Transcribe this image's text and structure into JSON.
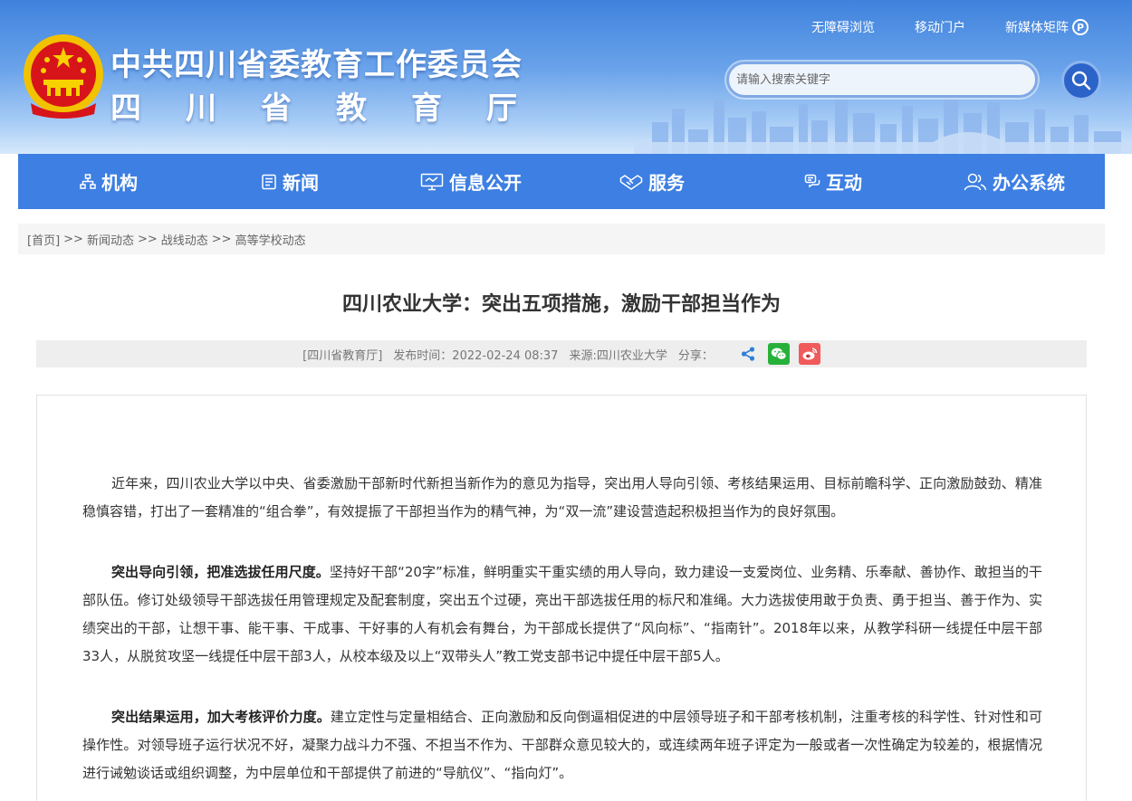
{
  "header": {
    "title_line1": "中共四川省委教育工作委员会",
    "title_line2": "四川省教育厅",
    "top_links": [
      "无障碍浏览",
      "移动门户",
      "新媒体矩阵"
    ],
    "search_placeholder": "请输入搜索关键字"
  },
  "nav": {
    "items": [
      {
        "label": "机构",
        "icon": "org-icon"
      },
      {
        "label": "新闻",
        "icon": "news-icon"
      },
      {
        "label": "信息公开",
        "icon": "monitor-icon"
      },
      {
        "label": "服务",
        "icon": "handshake-icon"
      },
      {
        "label": "互动",
        "icon": "chat-icon"
      },
      {
        "label": "办公系统",
        "icon": "users-icon"
      }
    ]
  },
  "breadcrumb": {
    "home": "[首页]",
    "separator": ">>",
    "items": [
      "新闻动态",
      "战线动态",
      "高等学校动态"
    ]
  },
  "article": {
    "title": "四川农业大学：突出五项措施，激励干部担当作为",
    "meta_site": "[四川省教育厅]",
    "meta_date": "发布时间：2022-02-24 08:37",
    "meta_source": "来源:四川农业大学",
    "share_label": "分享：",
    "paragraphs": [
      {
        "lead": "",
        "text": "近年来，四川农业大学以中央、省委激励干部新时代新担当新作为的意见为指导，突出用人导向引领、考核结果运用、目标前瞻科学、正向激励鼓劲、精准稳慎容错，打出了一套精准的“组合拳”，有效提振了干部担当作为的精气神，为“双一流”建设营造起积极担当作为的良好氛围。"
      },
      {
        "lead": "突出导向引领，把准选拔任用尺度。",
        "text": "坚持好干部“20字”标准，鲜明重实干重实绩的用人导向，致力建设一支爱岗位、业务精、乐奉献、善协作、敢担当的干部队伍。修订处级领导干部选拔任用管理规定及配套制度，突出五个过硬，亮出干部选拔任用的标尺和准绳。大力选拔使用敢于负责、勇于担当、善于作为、实绩突出的干部，让想干事、能干事、干成事、干好事的人有机会有舞台，为干部成长提供了“风向标”、“指南针”。2018年以来，从教学科研一线提任中层干部33人，从脱贫攻坚一线提任中层干部3人，从校本级及以上“双带头人”教工党支部书记中提任中层干部5人。"
      },
      {
        "lead": "突出结果运用，加大考核评价力度。",
        "text": "建立定性与定量相结合、正向激励和反向倒逼相促进的中层领导班子和干部考核机制，注重考核的科学性、针对性和可操作性。对领导班子运行状况不好，凝聚力战斗力不强、不担当不作为、干部群众意见较大的，或连续两年班子评定为一般或者一次性确定为较差的，根据情况进行诫勉谈话或组织调整，为中层单位和干部提供了前进的“导航仪”、“指向灯”。"
      }
    ]
  },
  "colors": {
    "nav_bg": "#3d7fe2",
    "header_top": "#3f82dd",
    "wechat": "#27b13a",
    "weibo": "#f05a5a"
  }
}
